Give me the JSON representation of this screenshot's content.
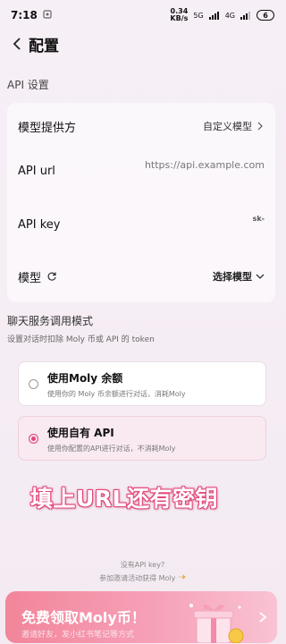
{
  "status": {
    "time": "7:18",
    "net_speed_top": "0.34",
    "net_speed_bottom": "KB/s",
    "signal1": "5G",
    "signal2": "4G",
    "battery": "6"
  },
  "header": {
    "title": "配置"
  },
  "api_section": {
    "title": "API 设置"
  },
  "provider": {
    "label": "模型提供方",
    "value": "自定义模型"
  },
  "api_url": {
    "label": "API url",
    "value": "https://api.example.com"
  },
  "api_key": {
    "label": "API key",
    "value": "sk-"
  },
  "model": {
    "label": "模型",
    "value": "选择模型"
  },
  "mode": {
    "title": "聊天服务调用模式",
    "subtitle": "设置对话时扣除 Moly 币或 API 的 token",
    "options": [
      {
        "title": "使用Moly 余额",
        "desc": "使用你的 Moly 币余额进行对话，消耗Moly",
        "selected": false
      },
      {
        "title": "使用自有 API",
        "desc": "使用你配置的API进行对话，不消耗Moly",
        "selected": true
      }
    ]
  },
  "overlay_caption": "填上URL还有密钥",
  "hint": {
    "line1": "没有API key?",
    "line2": "参加邀请活动获得 Moly"
  },
  "banner": {
    "title": "免费领取Moly币！",
    "subtitle": "邀请好友，发小红书笔记等方式"
  },
  "colors": {
    "accent": "#e6457a",
    "banner_start": "#f2859a",
    "banner_end": "#f9c3d3"
  }
}
